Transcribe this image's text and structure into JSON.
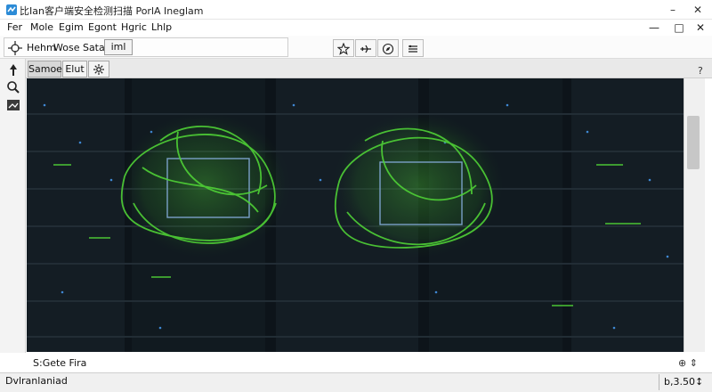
{
  "window": {
    "title": "比Ian客户端安全检测扫描 PorlA Ineglam",
    "minimize_glyph": "–",
    "close_glyph": "✕"
  },
  "menu": {
    "items": [
      "Fer",
      "Mole",
      "Egim",
      "Egont",
      "Hgric",
      "Lhlp"
    ],
    "restore_glyph": "□",
    "minimize_glyph": "—",
    "close_glyph": "✕"
  },
  "toolbar": {
    "left_label": "Hehm",
    "field_label": "Wose Satars --",
    "button_label": "iml",
    "icons": [
      "star-icon",
      "plane-icon",
      "compass-icon",
      "stack-icon"
    ]
  },
  "tabs": [
    {
      "label": "Samoe",
      "active": true
    },
    {
      "label": "Elut",
      "active": false
    }
  ],
  "help_glyph": "?",
  "status": {
    "left": "S:Gete Fira",
    "icons": "⊕ ⇕",
    "bottom_left": "Dvlranlaniad",
    "bottom_right": "b,3.50↕"
  },
  "colors": {
    "accent_green": "#4fd136",
    "viewport_bg": "#0c1318",
    "rack_led": "#4aa3ff"
  }
}
